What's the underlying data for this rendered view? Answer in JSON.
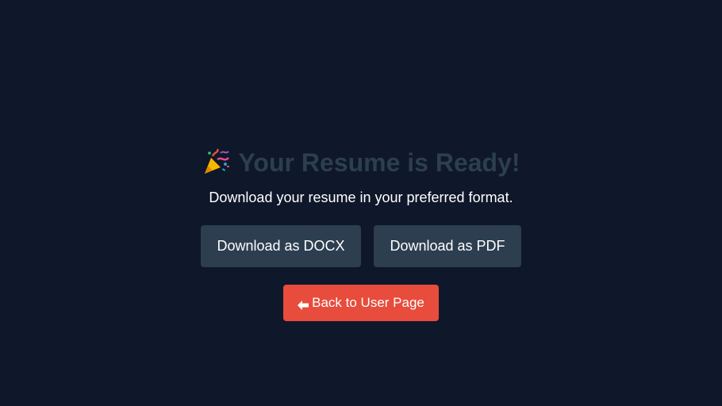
{
  "header": {
    "icon": "party-popper-icon",
    "title": "Your Resume is Ready!"
  },
  "subtitle": "Download your resume in your preferred format.",
  "actions": {
    "docx_label": "Download as DOCX",
    "pdf_label": "Download as PDF",
    "back_icon": "left-arrow-icon",
    "back_label": "Back to User Page"
  },
  "colors": {
    "background": "#0f172a",
    "title": "#2c3e50",
    "button_dark": "#2c3e50",
    "button_back": "#e74c3c",
    "text": "#ffffff"
  }
}
